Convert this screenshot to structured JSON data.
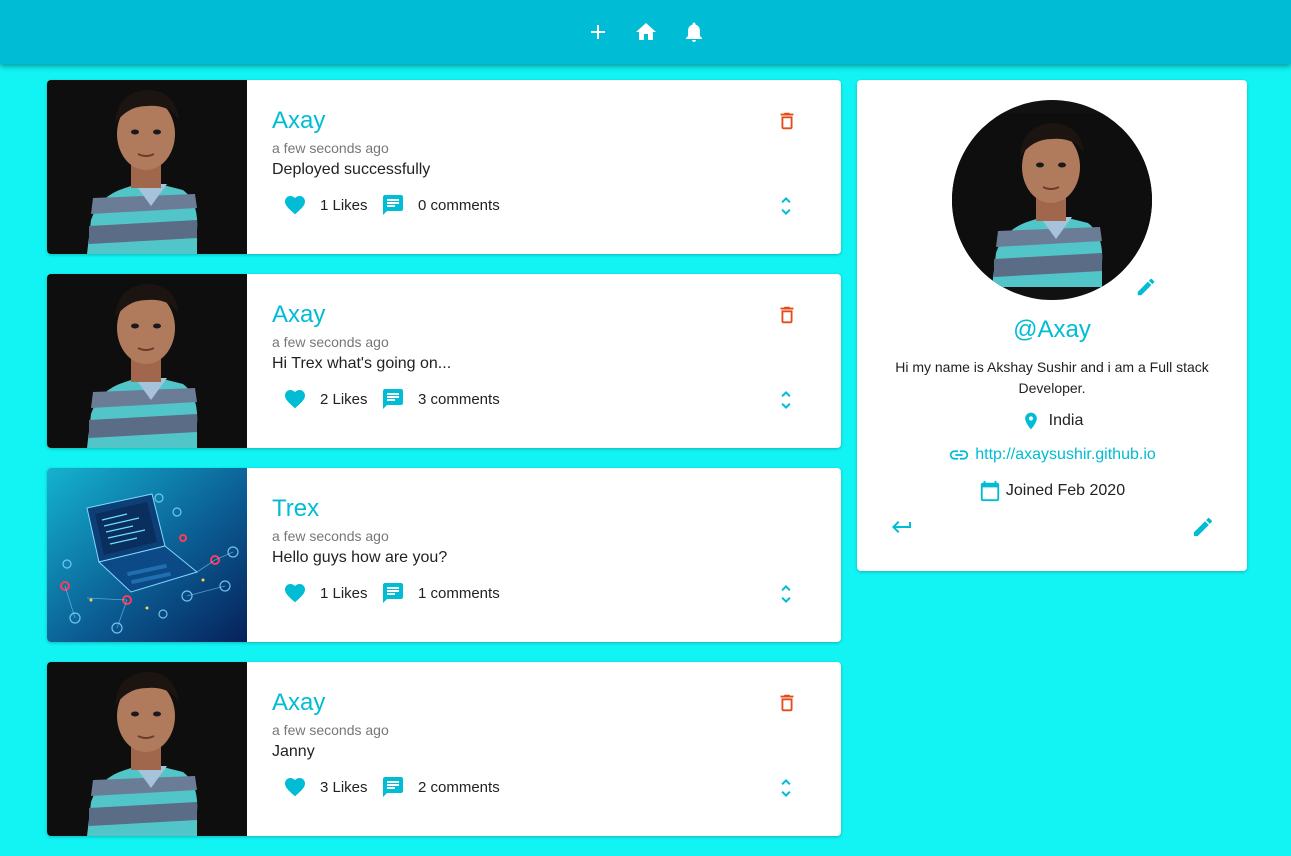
{
  "nav": {
    "icons": [
      "add-icon",
      "home-icon",
      "notifications-icon"
    ]
  },
  "posts": [
    {
      "user": "Axay",
      "time": "a few seconds ago",
      "body": "Deployed successfully",
      "likes": "1 Likes",
      "comments": "0 comments",
      "image": "user-photo",
      "deletable": true
    },
    {
      "user": "Axay",
      "time": "a few seconds ago",
      "body": "Hi Trex what's going on...",
      "likes": "2 Likes",
      "comments": "3 comments",
      "image": "user-photo",
      "deletable": true
    },
    {
      "user": "Trex",
      "time": "a few seconds ago",
      "body": "Hello guys how are you?",
      "likes": "1 Likes",
      "comments": "1 comments",
      "image": "laptop-network-image",
      "deletable": false
    },
    {
      "user": "Axay",
      "time": "a few seconds ago",
      "body": "Janny",
      "likes": "3 Likes",
      "comments": "2 comments",
      "image": "user-photo",
      "deletable": true
    }
  ],
  "profile": {
    "handle": "@Axay",
    "bio": "Hi my name is Akshay Sushir and i am a Full stack Developer.",
    "location": "India",
    "website": "http://axaysushir.github.io",
    "joined": "Joined Feb 2020"
  },
  "colors": {
    "appbar": "#00bcd4",
    "background": "#12f4f4",
    "accent": "#00bcd4",
    "delete": "#e64a19"
  }
}
